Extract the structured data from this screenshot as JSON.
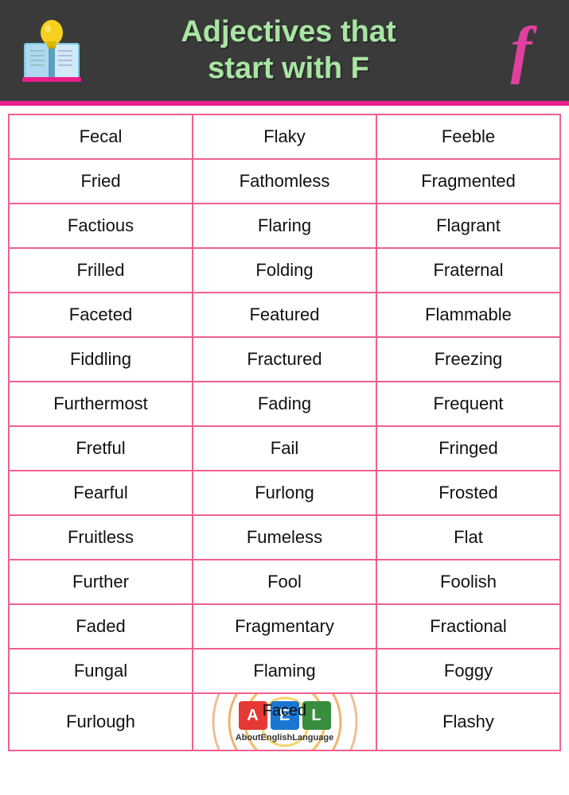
{
  "header": {
    "title_line1": "Adjectives that",
    "title_line2": "start with F",
    "letter": "f"
  },
  "table": {
    "rows": [
      [
        "Fecal",
        "Flaky",
        "Feeble"
      ],
      [
        "Fried",
        "Fathomless",
        "Fragmented"
      ],
      [
        "Factious",
        "Flaring",
        "Flagrant"
      ],
      [
        "Frilled",
        "Folding",
        "Fraternal"
      ],
      [
        "Faceted",
        "Featured",
        "Flammable"
      ],
      [
        "Fiddling",
        "Fractured",
        "Freezing"
      ],
      [
        "Furthermost",
        "Fading",
        "Frequent"
      ],
      [
        "Fretful",
        "Fail",
        "Fringed"
      ],
      [
        "Fearful",
        "Furlong",
        "Frosted"
      ],
      [
        "Fruitless",
        "Fumeless",
        "Flat"
      ],
      [
        "Further",
        "Fool",
        "Foolish"
      ],
      [
        "Faded",
        "Fragmentary",
        "Fractional"
      ],
      [
        "Fungal",
        "Flaming",
        "Foggy"
      ],
      [
        "Furlough",
        "Faced",
        "Flashy"
      ]
    ]
  },
  "logo": {
    "text": "About English Language",
    "letters": [
      "A",
      "E",
      "L"
    ]
  }
}
